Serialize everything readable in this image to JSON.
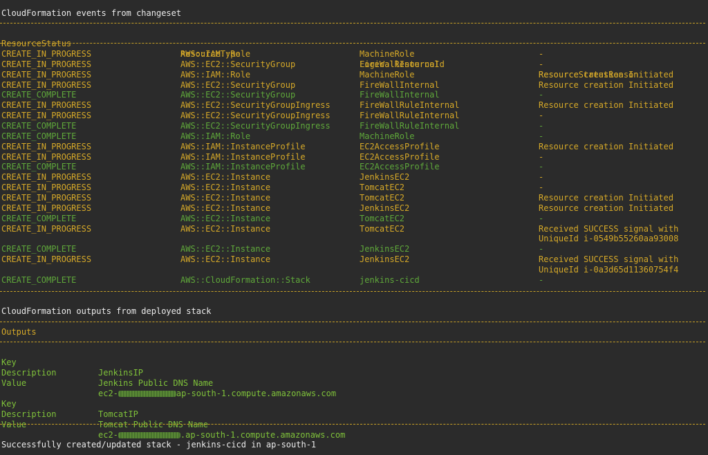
{
  "events_section": {
    "title": "CloudFormation events from changeset",
    "headers": [
      "ResourceStatus",
      "ResourceType",
      "LogicalResourceId",
      "ResourceStatusReason"
    ],
    "rows": [
      {
        "status": "CREATE_IN_PROGRESS",
        "type": "AWS::IAM::Role",
        "logical_id": "MachineRole",
        "reason": "-"
      },
      {
        "status": "CREATE_IN_PROGRESS",
        "type": "AWS::EC2::SecurityGroup",
        "logical_id": "FireWallInternal",
        "reason": "-"
      },
      {
        "status": "CREATE_IN_PROGRESS",
        "type": "AWS::IAM::Role",
        "logical_id": "MachineRole",
        "reason": "Resource creation Initiated"
      },
      {
        "status": "CREATE_IN_PROGRESS",
        "type": "AWS::EC2::SecurityGroup",
        "logical_id": "FireWallInternal",
        "reason": "Resource creation Initiated"
      },
      {
        "status": "CREATE_COMPLETE",
        "type": "AWS::EC2::SecurityGroup",
        "logical_id": "FireWallInternal",
        "reason": "-"
      },
      {
        "status": "CREATE_IN_PROGRESS",
        "type": "AWS::EC2::SecurityGroupIngress",
        "logical_id": "FireWallRuleInternal",
        "reason": "Resource creation Initiated"
      },
      {
        "status": "CREATE_IN_PROGRESS",
        "type": "AWS::EC2::SecurityGroupIngress",
        "logical_id": "FireWallRuleInternal",
        "reason": "-"
      },
      {
        "status": "CREATE_COMPLETE",
        "type": "AWS::EC2::SecurityGroupIngress",
        "logical_id": "FireWallRuleInternal",
        "reason": "-"
      },
      {
        "status": "CREATE_COMPLETE",
        "type": "AWS::IAM::Role",
        "logical_id": "MachineRole",
        "reason": "-"
      },
      {
        "status": "CREATE_IN_PROGRESS",
        "type": "AWS::IAM::InstanceProfile",
        "logical_id": "EC2AccessProfile",
        "reason": "Resource creation Initiated"
      },
      {
        "status": "CREATE_IN_PROGRESS",
        "type": "AWS::IAM::InstanceProfile",
        "logical_id": "EC2AccessProfile",
        "reason": "-"
      },
      {
        "status": "CREATE_COMPLETE",
        "type": "AWS::IAM::InstanceProfile",
        "logical_id": "EC2AccessProfile",
        "reason": "-"
      },
      {
        "status": "CREATE_IN_PROGRESS",
        "type": "AWS::EC2::Instance",
        "logical_id": "JenkinsEC2",
        "reason": "-"
      },
      {
        "status": "CREATE_IN_PROGRESS",
        "type": "AWS::EC2::Instance",
        "logical_id": "TomcatEC2",
        "reason": "-"
      },
      {
        "status": "CREATE_IN_PROGRESS",
        "type": "AWS::EC2::Instance",
        "logical_id": "TomcatEC2",
        "reason": "Resource creation Initiated"
      },
      {
        "status": "CREATE_IN_PROGRESS",
        "type": "AWS::EC2::Instance",
        "logical_id": "JenkinsEC2",
        "reason": "Resource creation Initiated"
      },
      {
        "status": "CREATE_COMPLETE",
        "type": "AWS::EC2::Instance",
        "logical_id": "TomcatEC2",
        "reason": "-"
      },
      {
        "status": "CREATE_IN_PROGRESS",
        "type": "AWS::EC2::Instance",
        "logical_id": "TomcatEC2",
        "reason": "Received SUCCESS signal with",
        "reason2": "UniqueId i-0549b55260aa93008"
      },
      {
        "status": "CREATE_COMPLETE",
        "type": "AWS::EC2::Instance",
        "logical_id": "JenkinsEC2",
        "reason": "-"
      },
      {
        "status": "CREATE_IN_PROGRESS",
        "type": "AWS::EC2::Instance",
        "logical_id": "JenkinsEC2",
        "reason": "Received SUCCESS signal with",
        "reason2": "UniqueId i-0a3d65d11360754f4"
      },
      {
        "status": "CREATE_COMPLETE",
        "type": "AWS::CloudFormation::Stack",
        "logical_id": "jenkins-cicd",
        "reason": "-"
      }
    ]
  },
  "outputs_section": {
    "title": "CloudFormation outputs from deployed stack",
    "header": "Outputs",
    "entries": [
      {
        "key_label": "Key",
        "key": "JenkinsIP",
        "desc_label": "Description",
        "description": "Jenkins Public DNS Name",
        "value_label": "Value",
        "value_prefix": "ec2-",
        "value_suffix": "ap-south-1.compute.amazonaws.com"
      },
      {
        "key_label": "Key",
        "key": "TomcatIP",
        "desc_label": "Description",
        "description": "Tomcat Public DNS Name",
        "value_label": "Value",
        "value_prefix": "ec2-",
        "value_suffix": ".ap-south-1.compute.amazonaws.com"
      }
    ]
  },
  "final_message": "Successfully created/updated stack - jenkins-cicd in ap-south-1",
  "colors": {
    "background": "#2b2b2b",
    "in_progress": "#d6a928",
    "complete": "#5fa83a",
    "text": "#ececec"
  }
}
